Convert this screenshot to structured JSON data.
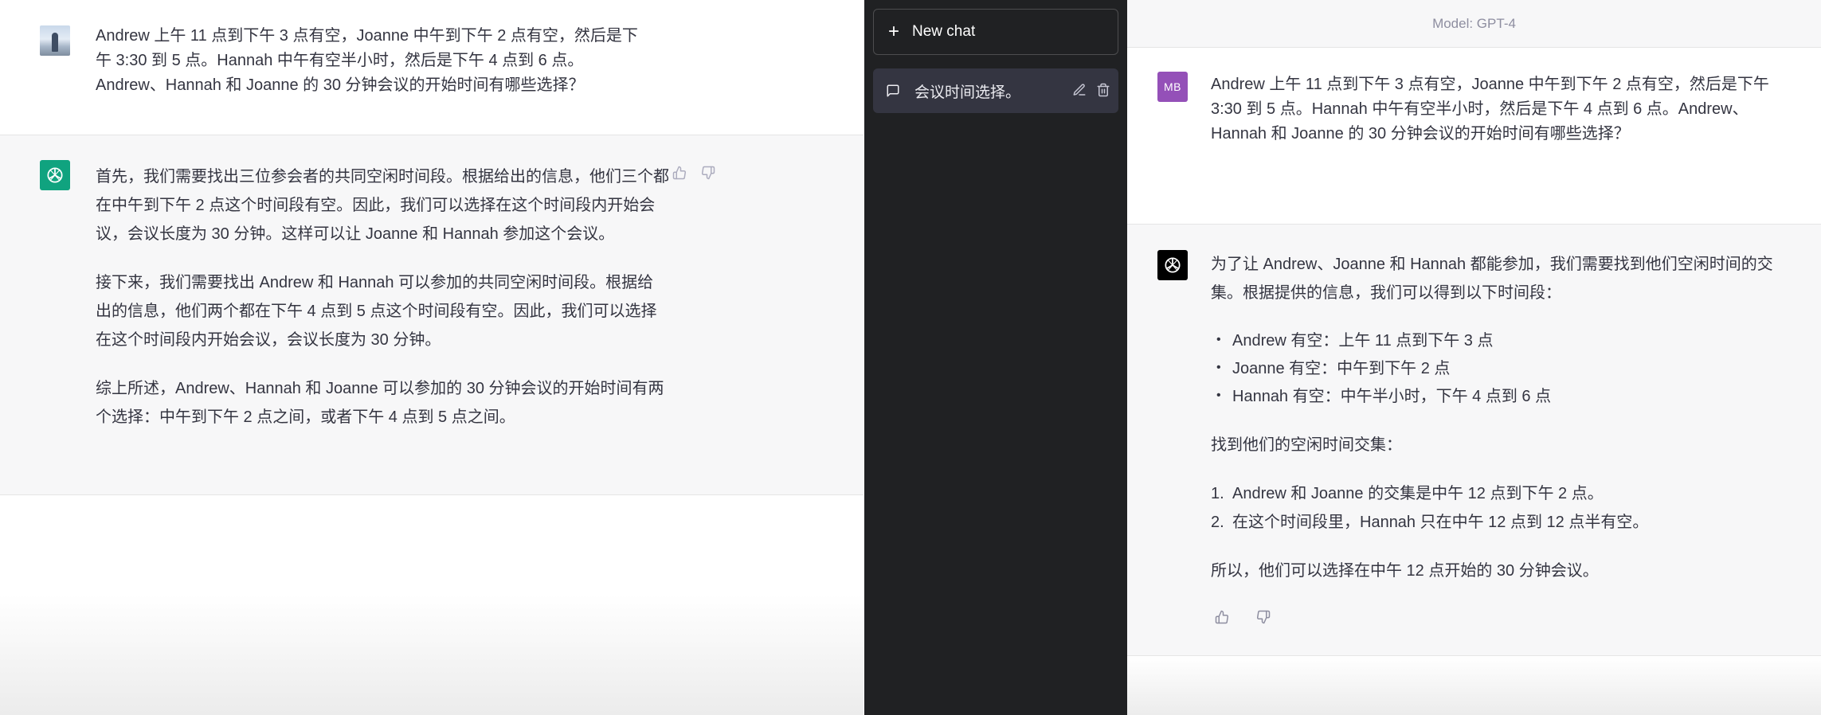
{
  "left": {
    "user_message": "Andrew 上午 11 点到下午 3 点有空，Joanne 中午到下午 2 点有空，然后是下午 3:30 到 5 点。Hannah 中午有空半小时，然后是下午 4 点到 6 点。Andrew、Hannah 和 Joanne 的 30 分钟会议的开始时间有哪些选择？",
    "assistant_paragraphs": [
      "首先，我们需要找出三位参会者的共同空闲时间段。根据给出的信息，他们三个都在中午到下午 2 点这个时间段有空。因此，我们可以选择在这个时间段内开始会议，会议长度为 30 分钟。这样可以让 Joanne 和 Hannah 参加这个会议。",
      "接下来，我们需要找出 Andrew 和 Hannah 可以参加的共同空闲时间段。根据给出的信息，他们两个都在下午 4 点到 5 点这个时间段有空。因此，我们可以选择在这个时间段内开始会议，会议长度为 30 分钟。",
      "综上所述，Andrew、Hannah 和 Joanne 可以参加的 30 分钟会议的开始时间有两个选择：中午到下午 2 点之间，或者下午 4 点到 5 点之间。"
    ]
  },
  "sidebar": {
    "new_chat_label": "New chat",
    "conversation_title": "会议时间选择。"
  },
  "right": {
    "model_label": "Model: GPT-4",
    "user_avatar_initials": "MB",
    "user_message": "Andrew 上午 11 点到下午 3 点有空，Joanne 中午到下午 2 点有空，然后是下午 3:30 到 5 点。Hannah 中午有空半小时，然后是下午 4 点到 6 点。Andrew、Hannah 和 Joanne 的 30 分钟会议的开始时间有哪些选择？",
    "assistant": {
      "intro": "为了让 Andrew、Joanne 和 Hannah 都能参加，我们需要找到他们空闲时间的交集。根据提供的信息，我们可以得到以下时间段：",
      "bullets": [
        "Andrew 有空：上午 11 点到下午 3 点",
        "Joanne 有空：中午到下午 2 点",
        "Hannah 有空：中午半小时，下午 4 点到 6 点"
      ],
      "middle": "找到他们的空闲时间交集：",
      "numbered": [
        {
          "num": "1.",
          "text": "Andrew 和 Joanne 的交集是中午 12 点到下午 2 点。"
        },
        {
          "num": "2.",
          "text": "在这个时间段里，Hannah 只在中午 12 点到 12 点半有空。"
        }
      ],
      "conclusion": "所以，他们可以选择在中午 12 点开始的 30 分钟会议。"
    }
  },
  "colors": {
    "sidebar_bg": "#202123",
    "sidebar_selected": "#343541",
    "assistant_row_bg": "#f7f7f8",
    "gpt_logo_green": "#10a37f",
    "gpt_logo_black": "#000000",
    "user_avatar_purple": "#9450b8"
  },
  "icons": [
    "openai-logo-icon",
    "thumbs-up-icon",
    "thumbs-down-icon",
    "plus-icon",
    "chat-bubble-icon",
    "edit-icon",
    "trash-icon"
  ]
}
